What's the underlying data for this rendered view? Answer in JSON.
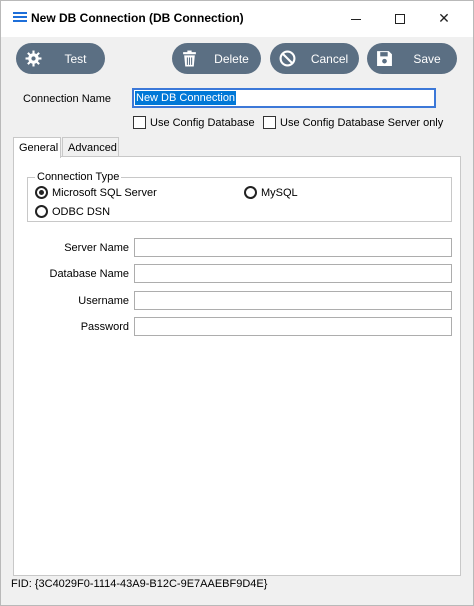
{
  "window": {
    "title": "New DB Connection (DB Connection)",
    "controls": {
      "minimize": "",
      "maximize": "",
      "close": "✕"
    }
  },
  "toolbar": {
    "test_label": "Test",
    "delete_label": "Delete",
    "cancel_label": "Cancel",
    "save_label": "Save",
    "button_color": "#5b6f83"
  },
  "form": {
    "connection_name_label": "Connection Name",
    "connection_name_value": "New DB Connection",
    "use_config_db_label": "Use Config Database",
    "use_config_db_server_label": "Use Config Database Server only"
  },
  "tabs": [
    {
      "label": "General",
      "active": true
    },
    {
      "label": "Advanced",
      "active": false
    }
  ],
  "connection_type": {
    "title": "Connection Type",
    "options": [
      {
        "label": "Microsoft SQL Server",
        "selected": true
      },
      {
        "label": "MySQL",
        "selected": false
      },
      {
        "label": "ODBC DSN",
        "selected": false
      }
    ]
  },
  "fields": {
    "server_name_label": "Server Name",
    "database_name_label": "Database Name",
    "username_label": "Username",
    "password_label": "Password"
  },
  "footer": {
    "fid": "FID: {3C4029F0-1114-43A9-B12C-9E7AAEBF9D4E}"
  },
  "colors": {
    "accent": "#0078d7",
    "title_icon": "#1e6fd9"
  }
}
